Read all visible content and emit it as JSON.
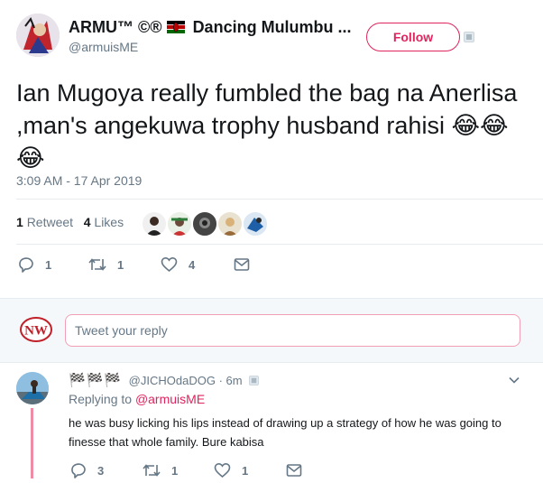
{
  "tweet": {
    "author": {
      "display_name": "ARMU™ ©® Dancing Mulumbu ...",
      "name_part1": "ARMU™ ©®",
      "name_part2": "Dancing Mulumbu ...",
      "handle": "@armuisME"
    },
    "follow_label": "Follow",
    "text": "Ian Mugoya really fumbled the bag na Anerlisa ,man's angekuwa trophy husband rahisi 😂😂😂",
    "timestamp": "3:09 AM - 17 Apr 2019",
    "stats": {
      "retweets_count": "1",
      "retweets_label": "Retweet",
      "likes_count": "4",
      "likes_label": "Likes"
    },
    "actions": {
      "reply_count": "1",
      "retweet_count": "1",
      "like_count": "4"
    }
  },
  "reply_box": {
    "logo_text": "NW",
    "placeholder": "Tweet your reply"
  },
  "reply": {
    "flags": "🏁🏁🏁",
    "handle": "@JICHOdaDOG",
    "separator": "·",
    "time": "6m",
    "replying_prefix": "Replying to",
    "replying_to": "@armuisME",
    "text": "he was busy licking his lips instead of drawing up a strategy of how he was going to finesse that whole family. Bure kabisa",
    "actions": {
      "reply_count": "3",
      "retweet_count": "1",
      "like_count": "1"
    }
  },
  "colors": {
    "accent": "#e0245e",
    "secondary_text": "#657786",
    "primary_text": "#14171a",
    "divider": "#e6ecf0"
  }
}
